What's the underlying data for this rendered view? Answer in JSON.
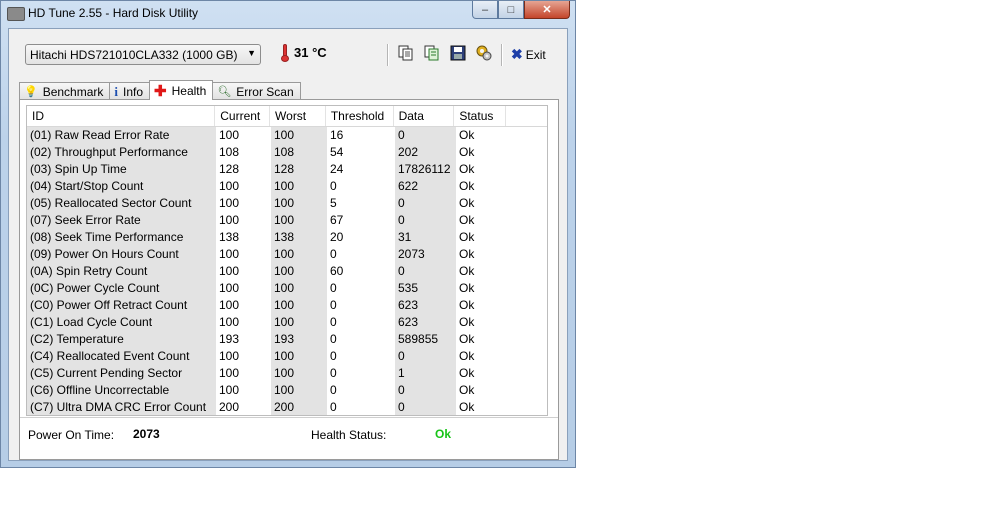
{
  "window": {
    "title": "HD Tune 2.55 - Hard Disk Utility",
    "minimize_glyph": "–",
    "maximize_glyph": "□",
    "close_glyph": "✕"
  },
  "toolbar": {
    "drive": "Hitachi HDS721010CLA332 (1000 GB)",
    "temperature": "31 °C",
    "exit_label": "Exit",
    "icons": [
      "copy-icon",
      "copy-all-icon",
      "save-icon",
      "options-icon"
    ]
  },
  "tabs": [
    {
      "label": "Benchmark",
      "icon": "benchmark-icon"
    },
    {
      "label": "Info",
      "icon": "info-icon"
    },
    {
      "label": "Health",
      "icon": "health-icon",
      "active": true
    },
    {
      "label": "Error Scan",
      "icon": "error-scan-icon"
    }
  ],
  "columns": [
    "ID",
    "Current",
    "Worst",
    "Threshold",
    "Data",
    "Status"
  ],
  "rows": [
    [
      "(01) Raw Read Error Rate",
      "100",
      "100",
      "16",
      "0",
      "Ok"
    ],
    [
      "(02) Throughput Performance",
      "108",
      "108",
      "54",
      "202",
      "Ok"
    ],
    [
      "(03) Spin Up Time",
      "128",
      "128",
      "24",
      "17826112",
      "Ok"
    ],
    [
      "(04) Start/Stop Count",
      "100",
      "100",
      "0",
      "622",
      "Ok"
    ],
    [
      "(05) Reallocated Sector Count",
      "100",
      "100",
      "5",
      "0",
      "Ok"
    ],
    [
      "(07) Seek Error Rate",
      "100",
      "100",
      "67",
      "0",
      "Ok"
    ],
    [
      "(08) Seek Time Performance",
      "138",
      "138",
      "20",
      "31",
      "Ok"
    ],
    [
      "(09) Power On Hours Count",
      "100",
      "100",
      "0",
      "2073",
      "Ok"
    ],
    [
      "(0A) Spin Retry Count",
      "100",
      "100",
      "60",
      "0",
      "Ok"
    ],
    [
      "(0C) Power Cycle Count",
      "100",
      "100",
      "0",
      "535",
      "Ok"
    ],
    [
      "(C0) Power Off Retract Count",
      "100",
      "100",
      "0",
      "623",
      "Ok"
    ],
    [
      "(C1) Load Cycle Count",
      "100",
      "100",
      "0",
      "623",
      "Ok"
    ],
    [
      "(C2) Temperature",
      "193",
      "193",
      "0",
      "589855",
      "Ok"
    ],
    [
      "(C4) Reallocated Event Count",
      "100",
      "100",
      "0",
      "0",
      "Ok"
    ],
    [
      "(C5) Current Pending Sector",
      "100",
      "100",
      "0",
      "1",
      "Ok"
    ],
    [
      "(C6) Offline Uncorrectable",
      "100",
      "100",
      "0",
      "0",
      "Ok"
    ],
    [
      "(C7) Ultra DMA CRC Error Count",
      "200",
      "200",
      "0",
      "0",
      "Ok"
    ]
  ],
  "footer": {
    "power_on_label": "Power On Time:",
    "power_on_value": "2073",
    "health_label": "Health Status:",
    "health_value": "Ok"
  },
  "colors": {
    "health_ok": "#18c418",
    "shaded_column": "#e3e3e3"
  }
}
